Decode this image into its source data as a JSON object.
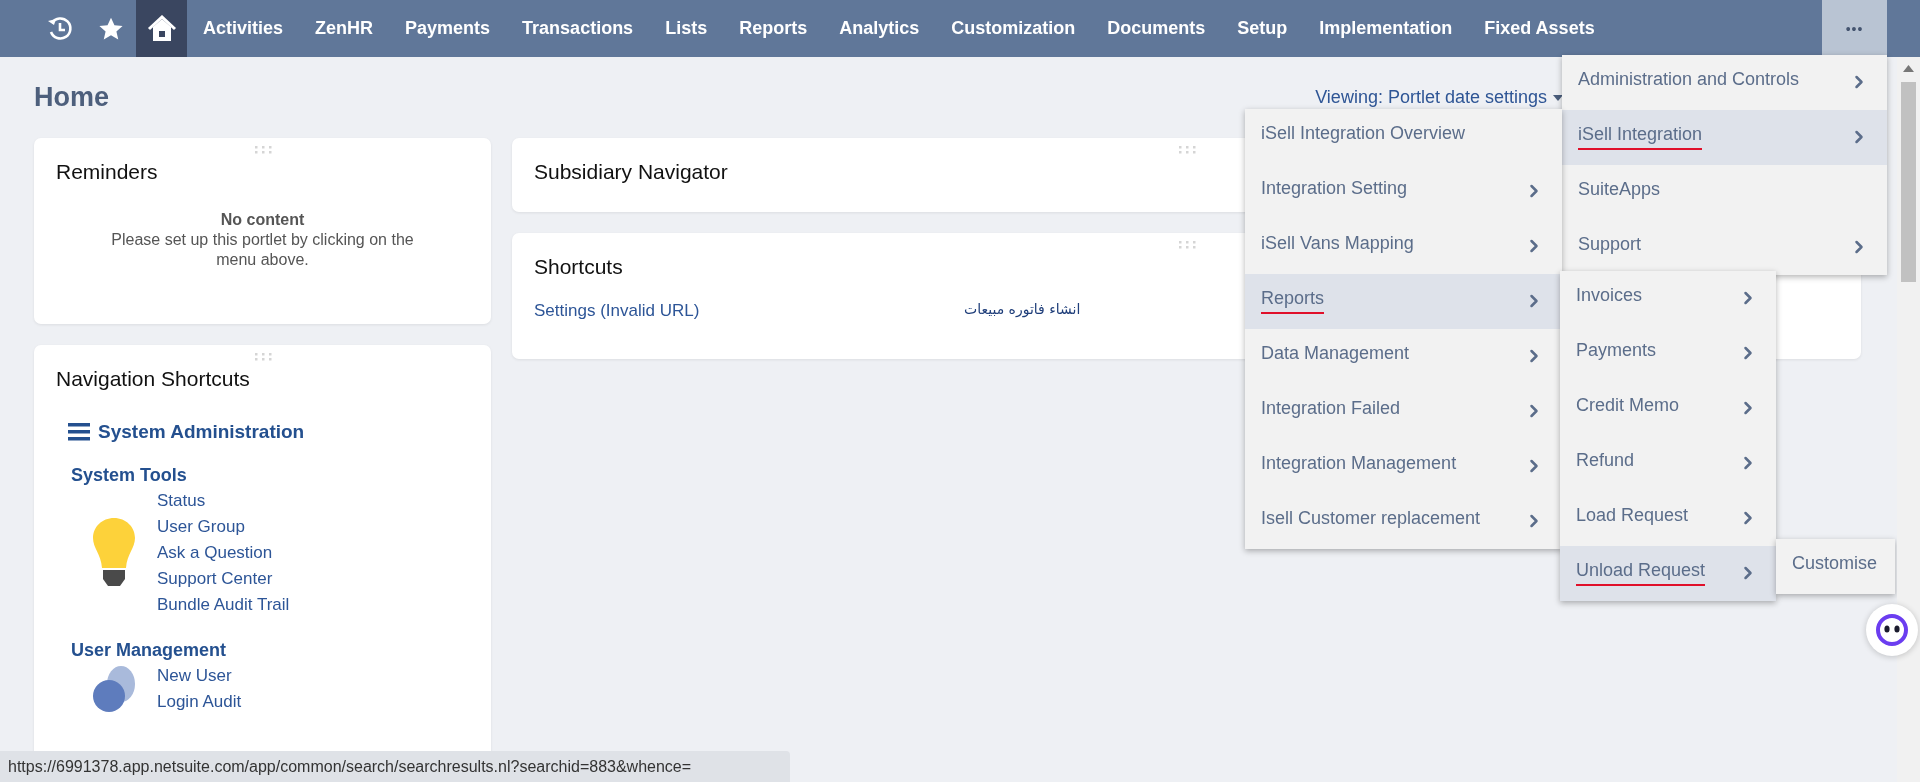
{
  "nav": {
    "icon_buttons": [
      {
        "kind": "recent",
        "selected": false
      },
      {
        "kind": "favorites",
        "selected": false
      },
      {
        "kind": "home",
        "selected": true
      }
    ],
    "items": [
      "Activities",
      "ZenHR",
      "Payments",
      "Transactions",
      "Lists",
      "Reports",
      "Analytics",
      "Customization",
      "Documents",
      "Setup",
      "Implementation",
      "Fixed Assets"
    ],
    "more": {
      "label": "•••",
      "open": true
    }
  },
  "page": {
    "title": "Home",
    "viewing": "Viewing: Portlet date settings"
  },
  "reminders": {
    "title": "Reminders",
    "empty_title": "No content",
    "empty_message": "Please set up this portlet by clicking on the menu above."
  },
  "navigation_shortcuts": {
    "title": "Navigation Shortcuts",
    "section": "System Administration",
    "groups": [
      {
        "title": "System Tools",
        "kind": "lightbulb",
        "links": [
          "Status",
          "User Group",
          "Ask a Question",
          "Support Center",
          "Bundle Audit Trail"
        ]
      },
      {
        "title": "User Management",
        "kind": "users",
        "links": [
          "New User",
          "Login Audit"
        ]
      }
    ]
  },
  "subsidiary_navigator": {
    "title": "Subsidiary Navigator"
  },
  "shortcuts": {
    "title": "Shortcuts",
    "links": [
      {
        "label": "Settings (Invalid URL)",
        "kind": "latin"
      },
      {
        "label": "انشاء فاتوره مبيعات",
        "kind": "arabic"
      }
    ]
  },
  "menus": [
    {
      "items": [
        {
          "label": "Administration and Controls",
          "submenu": true,
          "selected": false,
          "underlined": false
        },
        {
          "label": "iSell Integration",
          "submenu": true,
          "selected": true,
          "underlined": true
        },
        {
          "label": "SuiteApps",
          "submenu": false,
          "selected": false,
          "underlined": false
        },
        {
          "label": "Support",
          "submenu": true,
          "selected": false,
          "underlined": false
        }
      ]
    },
    {
      "items": [
        {
          "label": "iSell Integration Overview",
          "submenu": false,
          "selected": false,
          "underlined": false
        },
        {
          "label": "Integration Setting",
          "submenu": true,
          "selected": false,
          "underlined": false
        },
        {
          "label": "iSell Vans Mapping",
          "submenu": true,
          "selected": false,
          "underlined": false
        },
        {
          "label": "Reports",
          "submenu": true,
          "selected": true,
          "underlined": true
        },
        {
          "label": "Data Management",
          "submenu": true,
          "selected": false,
          "underlined": false
        },
        {
          "label": "Integration Failed",
          "submenu": true,
          "selected": false,
          "underlined": false
        },
        {
          "label": "Integration Management",
          "submenu": true,
          "selected": false,
          "underlined": false
        },
        {
          "label": "Isell Customer replacement",
          "submenu": true,
          "selected": false,
          "underlined": false
        }
      ]
    },
    {
      "items": [
        {
          "label": "Invoices",
          "submenu": true,
          "selected": false,
          "underlined": false
        },
        {
          "label": "Payments",
          "submenu": true,
          "selected": false,
          "underlined": false
        },
        {
          "label": "Credit Memo",
          "submenu": true,
          "selected": false,
          "underlined": false
        },
        {
          "label": "Refund",
          "submenu": true,
          "selected": false,
          "underlined": false
        },
        {
          "label": "Load Request",
          "submenu": true,
          "selected": false,
          "underlined": false
        },
        {
          "label": "Unload Request",
          "submenu": true,
          "selected": true,
          "underlined": true
        }
      ]
    },
    {
      "items": [
        {
          "label": "Customise",
          "submenu": false,
          "selected": false,
          "underlined": false
        }
      ]
    }
  ],
  "status_bar": {
    "url": "https://6991378.app.netsuite.com/app/common/search/searchresults.nl?searchid=883&whence="
  }
}
